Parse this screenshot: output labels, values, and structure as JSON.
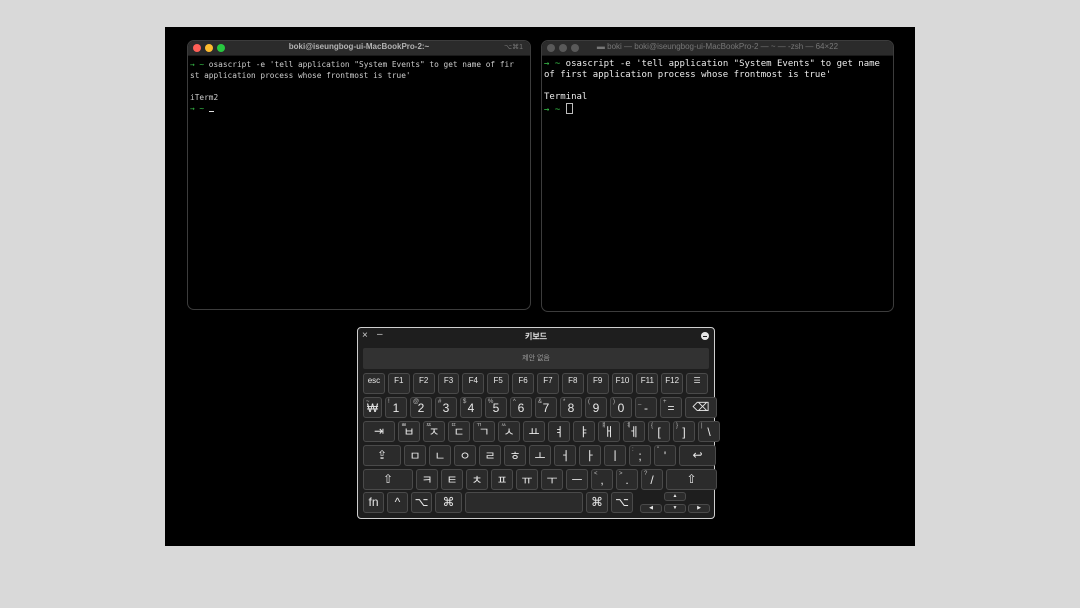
{
  "term1": {
    "title": "boki@iseungbog-ui-MacBookPro-2:~",
    "shortcut": "⌥⌘1",
    "lines": [
      {
        "prompt": "→ ~",
        "text": " osascript -e 'tell application \"System Events\" to get name of fir"
      },
      {
        "prompt": "",
        "text": "st application process whose frontmost is true'"
      },
      {
        "prompt": "",
        "text": ""
      },
      {
        "prompt": "",
        "text": "iTerm2"
      },
      {
        "prompt": "→ ~",
        "text": " "
      }
    ]
  },
  "term2": {
    "title": "boki — boki@iseungbog-ui-MacBookPro-2 — ~ — -zsh — 64×22",
    "lines": [
      {
        "prompt": "→ ~",
        "text": " osascript -e 'tell application \"System Events\" to get name"
      },
      {
        "prompt": "",
        "text": "of first application process whose frontmost is true'"
      },
      {
        "prompt": "",
        "text": ""
      },
      {
        "prompt": "",
        "text": "Terminal"
      },
      {
        "prompt": "→ ~",
        "text": " "
      }
    ]
  },
  "keyboard": {
    "title": "키보드",
    "close_icon": "×",
    "minimize_icon": "–",
    "suggestion": "제안 없음",
    "rows": [
      [
        {
          "m": "esc",
          "c": "fk"
        },
        {
          "m": "F1",
          "c": "fk"
        },
        {
          "m": "F2",
          "c": "fk"
        },
        {
          "m": "F3",
          "c": "fk"
        },
        {
          "m": "F4",
          "c": "fk"
        },
        {
          "m": "F5",
          "c": "fk"
        },
        {
          "m": "F6",
          "c": "fk"
        },
        {
          "m": "F7",
          "c": "fk"
        },
        {
          "m": "F8",
          "c": "fk"
        },
        {
          "m": "F9",
          "c": "fk"
        },
        {
          "m": "F10",
          "c": "fk"
        },
        {
          "m": "F11",
          "c": "fk"
        },
        {
          "m": "F12",
          "c": "fk"
        },
        {
          "m": "☰",
          "c": "fk"
        }
      ],
      [
        {
          "s": "~",
          "m": "₩"
        },
        {
          "s": "!",
          "m": "1"
        },
        {
          "s": "@",
          "m": "2"
        },
        {
          "s": "#",
          "m": "3"
        },
        {
          "s": "$",
          "m": "4"
        },
        {
          "s": "%",
          "m": "5"
        },
        {
          "s": "^",
          "m": "6"
        },
        {
          "s": "&",
          "m": "7"
        },
        {
          "s": "*",
          "m": "8"
        },
        {
          "s": "(",
          "m": "9"
        },
        {
          "s": ")",
          "m": "0"
        },
        {
          "s": "_",
          "m": "-"
        },
        {
          "s": "+",
          "m": "="
        },
        {
          "m": "⌫",
          "c": "mod"
        }
      ],
      [
        {
          "m": "⇥",
          "c": "mod"
        },
        {
          "s": "ㅃ",
          "m": "ㅂ"
        },
        {
          "s": "ㅉ",
          "m": "ㅈ"
        },
        {
          "s": "ㄸ",
          "m": "ㄷ"
        },
        {
          "s": "ㄲ",
          "m": "ㄱ"
        },
        {
          "s": "ㅆ",
          "m": "ㅅ"
        },
        {
          "m": "ㅛ"
        },
        {
          "m": "ㅕ"
        },
        {
          "m": "ㅑ"
        },
        {
          "s": "ㅒ",
          "m": "ㅐ"
        },
        {
          "s": "ㅖ",
          "m": "ㅔ"
        },
        {
          "s": "{",
          "m": "["
        },
        {
          "s": "}",
          "m": "]"
        },
        {
          "s": "|",
          "m": "\\"
        }
      ],
      [
        {
          "m": "⇪",
          "c": "mod"
        },
        {
          "m": "ㅁ"
        },
        {
          "m": "ㄴ"
        },
        {
          "m": "ㅇ"
        },
        {
          "m": "ㄹ"
        },
        {
          "m": "ㅎ"
        },
        {
          "m": "ㅗ"
        },
        {
          "m": "ㅓ"
        },
        {
          "m": "ㅏ"
        },
        {
          "m": "ㅣ"
        },
        {
          "s": ":",
          "m": ";"
        },
        {
          "s": "\"",
          "m": "'"
        },
        {
          "m": "↩",
          "c": "mod"
        }
      ],
      [
        {
          "m": "⇧",
          "c": "mod"
        },
        {
          "m": "ㅋ"
        },
        {
          "m": "ㅌ"
        },
        {
          "m": "ㅊ"
        },
        {
          "m": "ㅍ"
        },
        {
          "m": "ㅠ"
        },
        {
          "m": "ㅜ"
        },
        {
          "m": "ㅡ"
        },
        {
          "s": "<",
          "m": ","
        },
        {
          "s": ">",
          "m": "."
        },
        {
          "s": "?",
          "m": "/"
        },
        {
          "m": "⇧",
          "c": "mod"
        }
      ],
      [
        {
          "m": "fn",
          "c": "mod"
        },
        {
          "m": "^",
          "c": "mod"
        },
        {
          "m": "⌥",
          "c": "mod"
        },
        {
          "m": "⌘",
          "c": "mod"
        },
        {
          "m": "",
          "c": "mod"
        },
        {
          "m": "⌘",
          "c": "mod"
        },
        {
          "m": "⌥",
          "c": "mod"
        }
      ]
    ],
    "arrows": {
      "up": "▲",
      "left": "◀",
      "down": "▼",
      "right": "▶"
    }
  }
}
